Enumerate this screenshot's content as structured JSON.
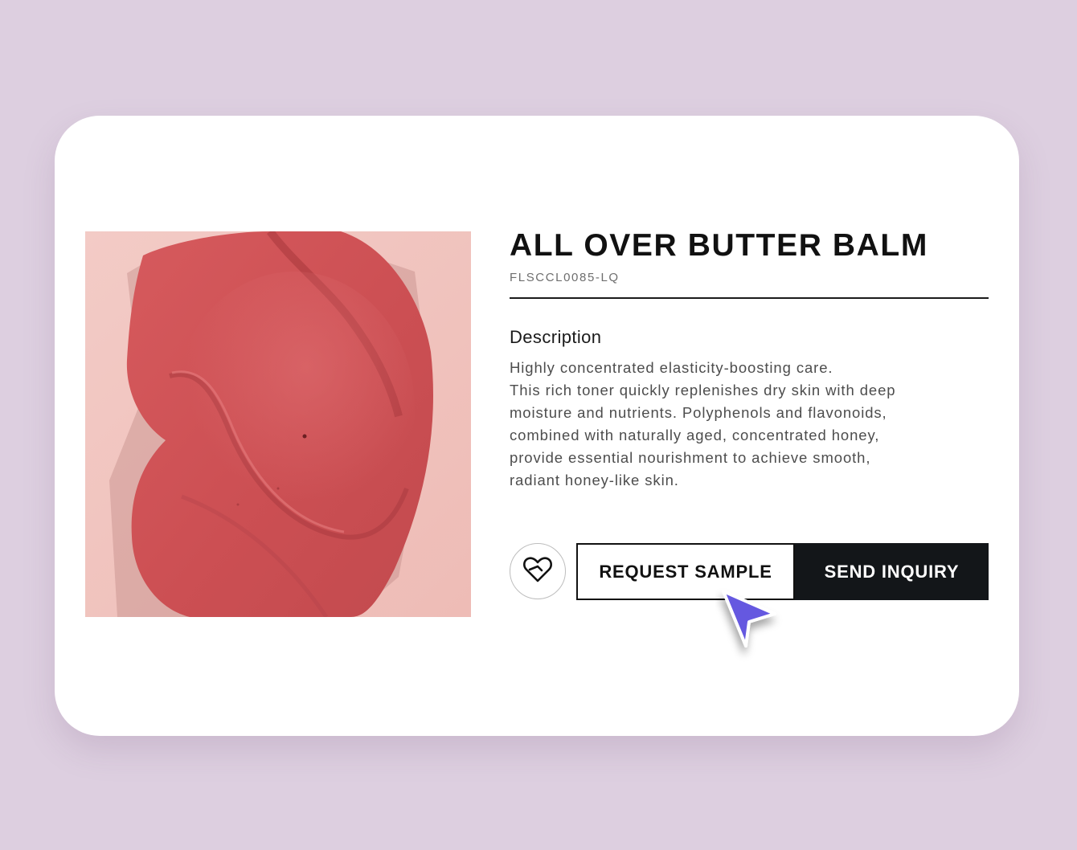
{
  "product": {
    "title": "ALL OVER BUTTER BALM",
    "sku": "FLSCCL0085-LQ",
    "image_icon": "product-swatch-image"
  },
  "description": {
    "heading": "Description",
    "lines": [
      "Highly concentrated elasticity-boosting care.",
      "This rich toner quickly replenishes dry skin with deep",
      "moisture and nutrients. Polyphenols and flavonoids,",
      "combined with naturally aged, concentrated honey,",
      "provide essential nourishment to achieve smooth,",
      "radiant honey-like skin."
    ]
  },
  "actions": {
    "favorite_icon": "heart-icon",
    "request_sample_label": "REQUEST SAMPLE",
    "send_inquiry_label": "SEND INQUIRY"
  },
  "colors": {
    "page_background": "#ddcfe0",
    "card_background": "#ffffff",
    "primary_button": "#131619",
    "cursor_accent": "#6558e0",
    "swatch_red": "#cc5256",
    "swatch_background": "#f0c4c0"
  },
  "cursor_icon": "pointer-arrow-icon"
}
